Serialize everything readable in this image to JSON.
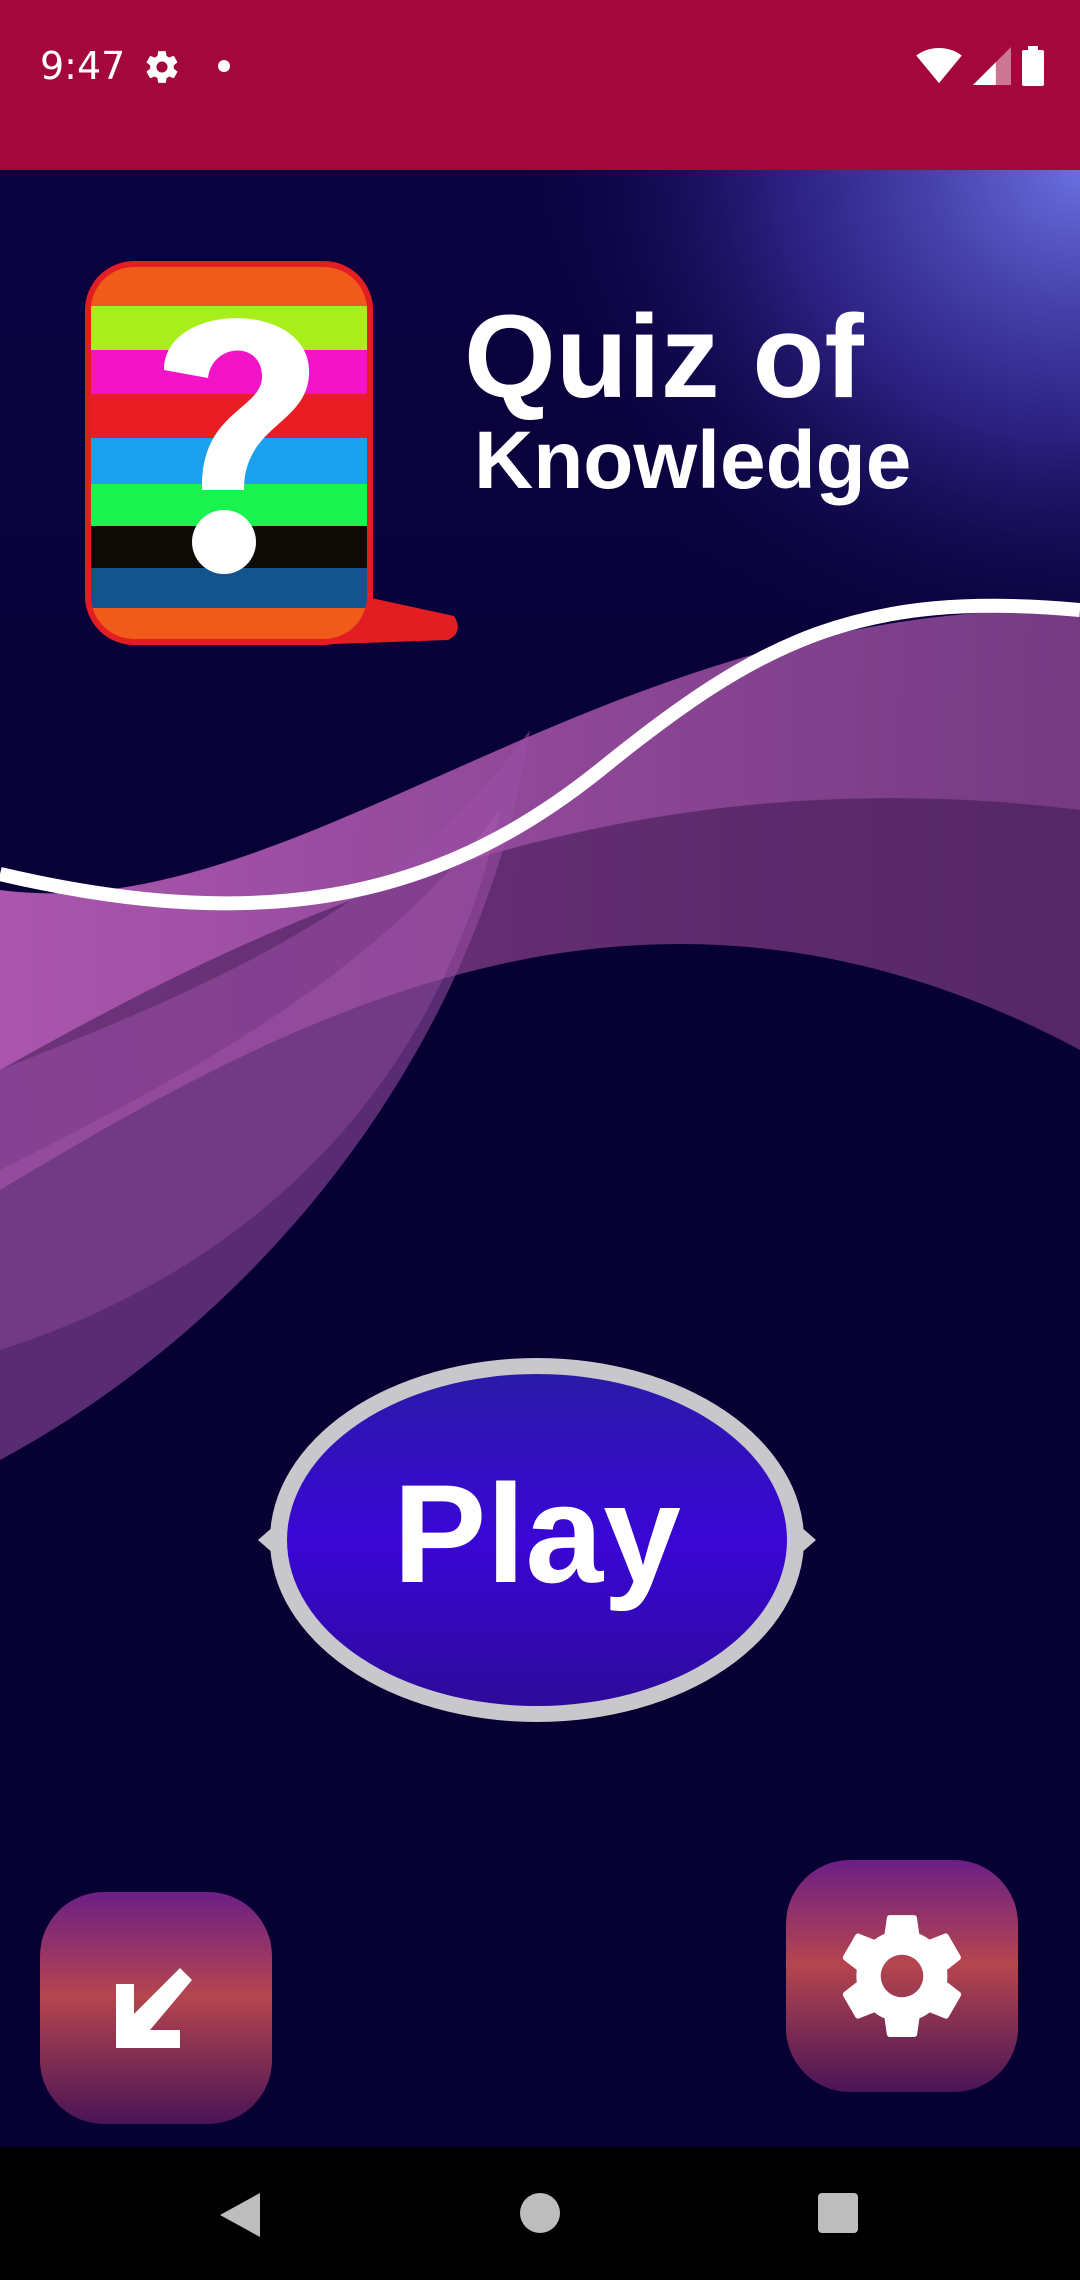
{
  "status_bar": {
    "time": "9:47",
    "icons": [
      "settings-icon",
      "notification-dot",
      "wifi-icon",
      "signal-icon",
      "battery-icon"
    ]
  },
  "title": {
    "line1": "Quiz of",
    "line2": "Knowledge"
  },
  "logo": {
    "icon": "question-mark-icon",
    "stripe_colors": [
      "#f05a1b",
      "#a7ee1a",
      "#f214c6",
      "#ea1d24",
      "#1aa0ec",
      "#19f24f",
      "#0e0b06",
      "#13548f",
      "#f05a1b"
    ]
  },
  "play_button": {
    "label": "Play"
  },
  "exit_button": {
    "icon": "arrow-down-left-icon"
  },
  "settings_button": {
    "icon": "gear-icon"
  },
  "nav_bar": {
    "icons": [
      "back-icon",
      "home-icon",
      "recents-icon"
    ]
  },
  "colors": {
    "status_bar": "#a3073b",
    "background_dark": "#070133",
    "background_blue": "#1e2bf5",
    "accent_purple": "#b35ab4",
    "play_fill": "#3a06d6"
  }
}
